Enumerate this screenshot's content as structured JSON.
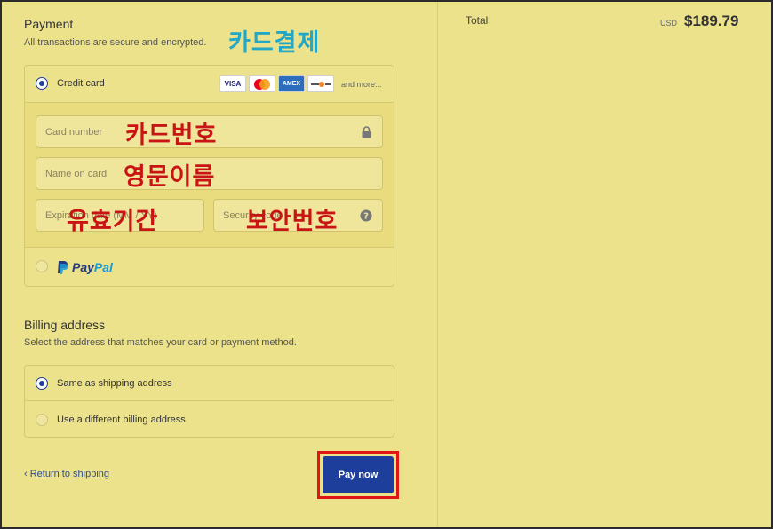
{
  "payment": {
    "title": "Payment",
    "subtitle": "All transactions are secure and encrypted.",
    "annotation": "카드결제",
    "credit_card": {
      "label": "Credit card",
      "card_brands": [
        "VISA",
        "MC",
        "AMEX",
        "DISC"
      ],
      "more": "and more...",
      "fields": {
        "card_number": {
          "placeholder": "Card number",
          "annotation": "카드번호"
        },
        "name_on_card": {
          "placeholder": "Name on card",
          "annotation": "영문이름"
        },
        "expiration": {
          "placeholder": "Expiration date (MM / YY)",
          "annotation": "유효기간"
        },
        "security_code": {
          "placeholder": "Security code",
          "annotation": "보안번호"
        }
      }
    },
    "paypal": {
      "label_part1": "Pay",
      "label_part2": "Pal"
    }
  },
  "billing": {
    "title": "Billing address",
    "subtitle": "Select the address that matches your card or payment method.",
    "options": [
      "Same as shipping address",
      "Use a different billing address"
    ]
  },
  "footer": {
    "return_label": "Return to shipping",
    "pay_label": "Pay now"
  },
  "summary": {
    "total_label": "Total",
    "currency": "USD",
    "total_value": "$189.79"
  },
  "colors": {
    "background": "#ece28b",
    "primary": "#1d3f9b",
    "highlight": "#e01515",
    "annotation_red": "#c81414",
    "annotation_cyan": "#23a7c6"
  }
}
